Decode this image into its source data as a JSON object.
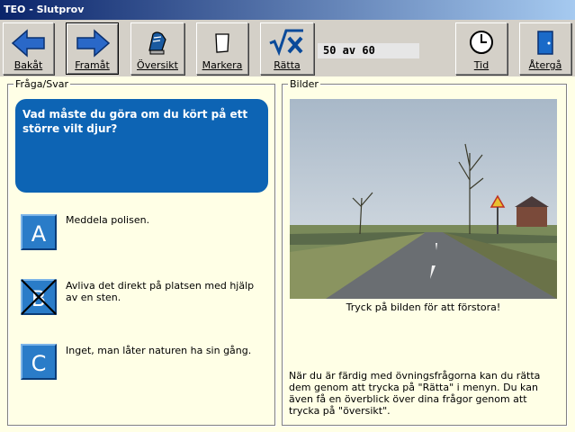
{
  "window": {
    "title": "TEO - Slutprov"
  },
  "toolbar": {
    "back_label": "Bakåt",
    "forward_label": "Framåt",
    "overview_label": "Översikt",
    "mark_label": "Markera",
    "grade_label": "Rätta",
    "time_label": "Tid",
    "return_label": "Återgå",
    "counter": "50 av 60"
  },
  "qa_panel": {
    "legend": "Fråga/Svar",
    "question": "Vad måste du göra om du kört på ett större vilt djur?",
    "answers": [
      {
        "letter": "A",
        "text": "Meddela polisen.",
        "crossed": false
      },
      {
        "letter": "B",
        "text": "Avliva det direkt på platsen med hjälp av en sten.",
        "crossed": true
      },
      {
        "letter": "C",
        "text": "Inget, man låter naturen ha sin gång.",
        "crossed": false
      }
    ]
  },
  "images_panel": {
    "legend": "Bilder",
    "caption": "Tryck på bilden för att förstora!",
    "info": "När du är färdig med övningsfrågorna kan du rätta dem genom att trycka på \"Rätta\" i menyn. Du kan även få en överblick över dina frågor genom att trycka på \"översikt\"."
  },
  "colors": {
    "question_bg": "#0d64b4",
    "answer_button": "#2a7cc8",
    "panel_bg": "#ffffe6"
  }
}
